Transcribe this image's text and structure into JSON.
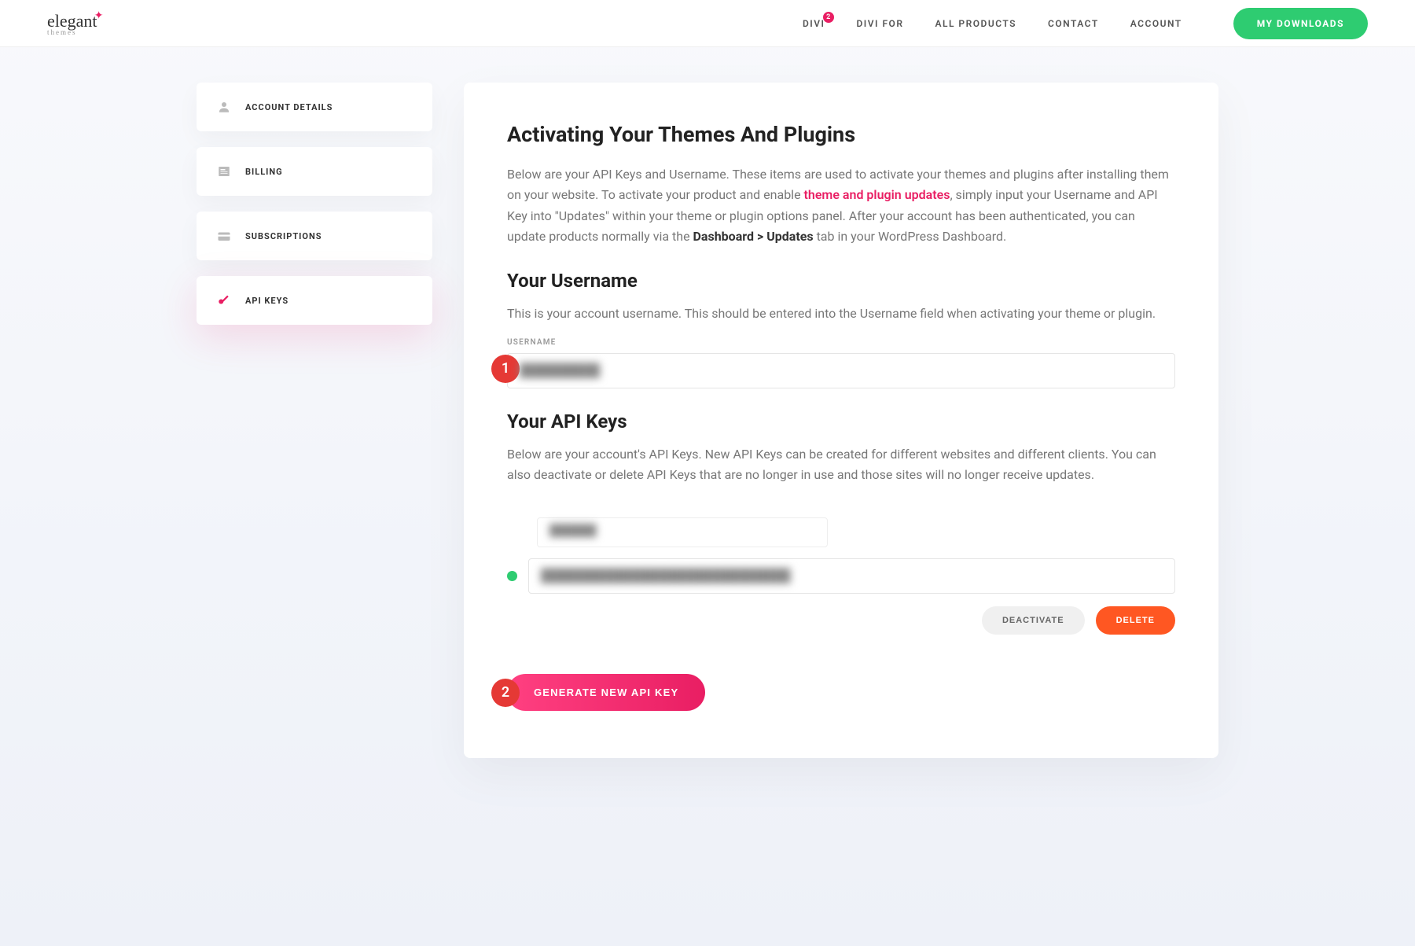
{
  "header": {
    "logo_main": "elegant",
    "logo_sub": "themes",
    "nav": {
      "divi": "DIVI",
      "divi_badge": "2",
      "divi_for": "DIVI FOR",
      "all_products": "ALL PRODUCTS",
      "contact": "CONTACT",
      "account": "ACCOUNT",
      "downloads": "MY DOWNLOADS"
    }
  },
  "sidebar": {
    "account": "ACCOUNT DETAILS",
    "billing": "BILLING",
    "subscriptions": "SUBSCRIPTIONS",
    "apikeys": "API KEYS"
  },
  "main": {
    "h1": "Activating Your Themes And Plugins",
    "p1_a": "Below are your API Keys and Username. These items are used to activate your themes and plugins after installing them on your website. To activate your product and enable ",
    "p1_link": "theme and plugin updates",
    "p1_b": ", simply input your Username and API Key into \"Updates\" within your theme or plugin options panel. After your account has been authenticated, you can update products normally via the ",
    "p1_bold": "Dashboard > Updates",
    "p1_c": " tab in your WordPress Dashboard.",
    "h2_user": "Your Username",
    "p2": "This is your account username. This should be entered into the Username field when activating your theme or plugin.",
    "username_label": "USERNAME",
    "username_value": "█████████",
    "h2_api": "Your API Keys",
    "p3": "Below are your account's API Keys. New API Keys can be created for different websites and different clients. You can also deactivate or delete API Keys that are no longer in use and those sites will no longer receive updates.",
    "api_label_value": "██████",
    "api_key_value": "████████████████████████████",
    "deactivate": "DEACTIVATE",
    "delete": "DELETE",
    "generate": "GENERATE NEW API KEY",
    "step1": "1",
    "step2": "2"
  }
}
